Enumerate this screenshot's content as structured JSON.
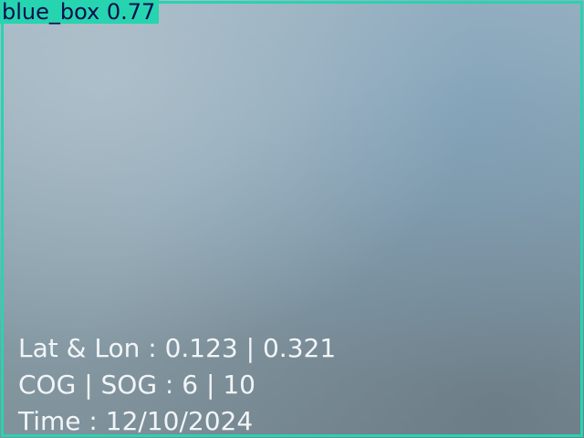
{
  "detection": {
    "label": "blue_box 0.77",
    "box_color": "#26d4b0",
    "label_text_color": "#0d0d4d"
  },
  "telemetry": {
    "lat_lon": "Lat & Lon : 0.123 | 0.321",
    "cog_sog": "COG | SOG : 6 | 10",
    "time": "Time : 12/10/2024"
  }
}
